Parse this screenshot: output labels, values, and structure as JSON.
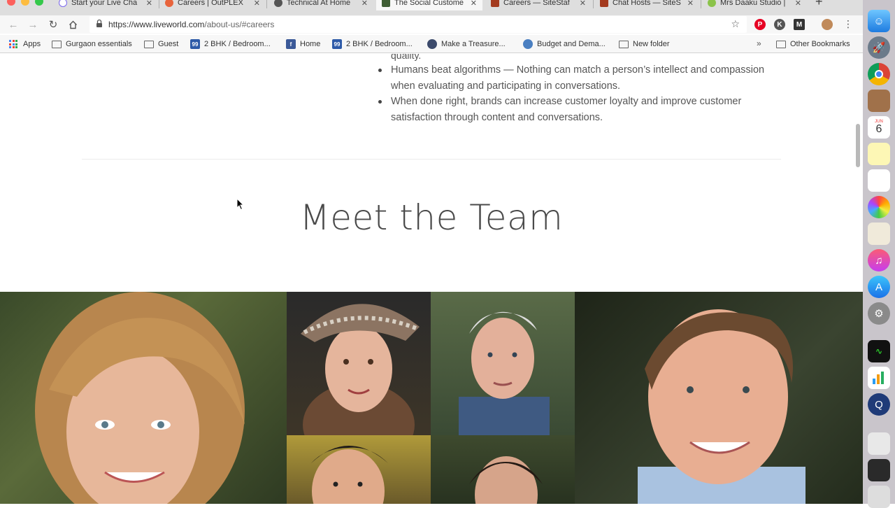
{
  "browser": {
    "tabs": [
      {
        "title": "Start your Live Cha",
        "color": "#7b68ee",
        "active": false
      },
      {
        "title": "Careers | OutPLEX",
        "color": "#e8643c",
        "active": false
      },
      {
        "title": "Technical At Home",
        "color": "#555555",
        "active": false
      },
      {
        "title": "The Social Custome",
        "color": "#3f5d34",
        "active": true
      },
      {
        "title": "Careers — SiteStaf",
        "color": "#a33a1e",
        "active": false
      },
      {
        "title": "Chat Hosts — SiteS",
        "color": "#a33a1e",
        "active": false
      },
      {
        "title": "Mrs Daaku Studio |",
        "color": "#8bc34a",
        "active": false
      }
    ],
    "url_host": "https://www.liveworld.com",
    "url_path": "/about-us/#careers",
    "bookmarks": [
      {
        "label": "Apps",
        "icon": "apps-grid-icon"
      },
      {
        "label": "Gurgaon essentials",
        "icon": "folder-icon"
      },
      {
        "label": "Guest",
        "icon": "folder-icon"
      },
      {
        "label": "2 BHK / Bedroom...",
        "icon": "99acres-icon",
        "badge": "99",
        "color": "#2d5aa8"
      },
      {
        "label": "Home",
        "icon": "facebook-icon",
        "badge": "f",
        "color": "#3b5998"
      },
      {
        "label": "2 BHK / Bedroom...",
        "icon": "99acres-icon",
        "badge": "99",
        "color": "#2d5aa8"
      },
      {
        "label": "Make a Treasure...",
        "icon": "treasure-icon",
        "badge": "",
        "color": "#3b4a6b"
      },
      {
        "label": "Budget and Dema...",
        "icon": "budget-icon",
        "badge": "",
        "color": "#4a7fc1"
      },
      {
        "label": "New folder",
        "icon": "folder-icon"
      }
    ],
    "other_bookmarks": "Other Bookmarks"
  },
  "page": {
    "fragment_text": "quality.",
    "bullets": [
      "Humans beat algorithms — Nothing can match a person’s intellect and compassion when evaluating and participating in conversations.",
      "When done right, brands can increase customer loyalty and improve customer satisfaction through content and conversations."
    ],
    "section_title": "Meet the Team"
  },
  "dock": {
    "date_day": "6",
    "date_month": "JUN"
  }
}
